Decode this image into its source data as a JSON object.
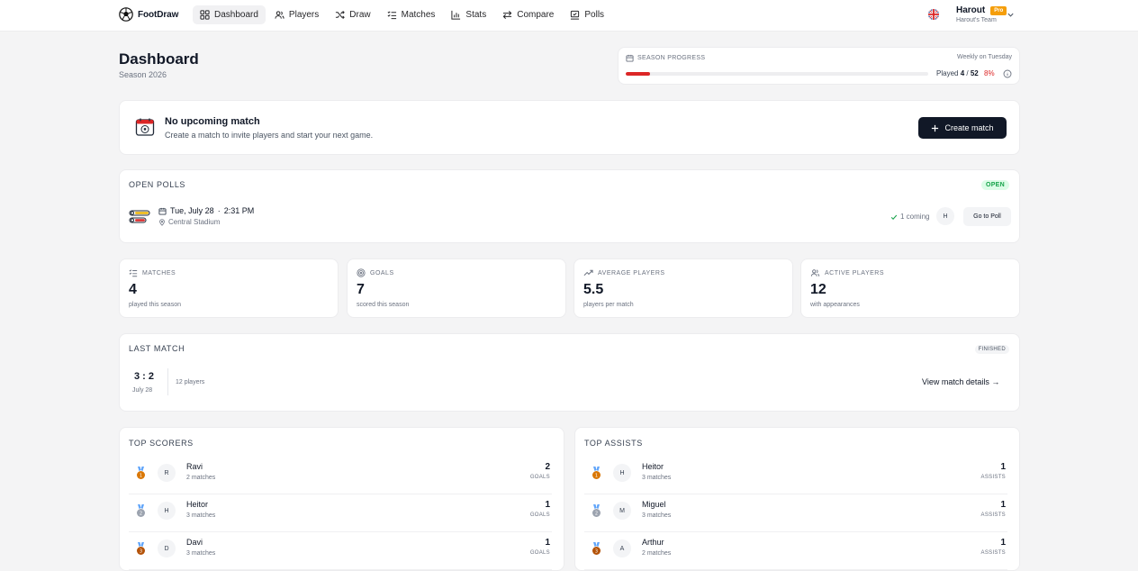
{
  "app": {
    "name": "FootDraw"
  },
  "nav": [
    {
      "label": "Dashboard",
      "icon": "dashboard-icon",
      "active": true
    },
    {
      "label": "Players",
      "icon": "users-icon"
    },
    {
      "label": "Draw",
      "icon": "shuffle-icon"
    },
    {
      "label": "Matches",
      "icon": "list-icon"
    },
    {
      "label": "Stats",
      "icon": "bar-chart-icon"
    },
    {
      "label": "Compare",
      "icon": "compare-icon"
    },
    {
      "label": "Polls",
      "icon": "poll-icon"
    }
  ],
  "user": {
    "name": "Harout",
    "badge": "Pro",
    "team": "Harout's Team"
  },
  "page": {
    "title": "Dashboard",
    "subtitle": "Season 2026"
  },
  "season_progress": {
    "label": "SEASON PROGRESS",
    "schedule": "Weekly on Tuesday",
    "played_prefix": "Played",
    "played": "4",
    "separator": "/",
    "total": "52",
    "percent_label": "8%",
    "percent": 8,
    "accent": "#dc2626"
  },
  "upcoming": {
    "title": "No upcoming match",
    "description": "Create a match to invite players and start your next game.",
    "button": "Create match"
  },
  "polls": {
    "title": "OPEN POLLS",
    "status": "OPEN",
    "date": "Tue, July 28",
    "dot": "·",
    "time": "2:31 PM",
    "location": "Central Stadium",
    "coming": "1 coming",
    "avatar": "H",
    "button": "Go to Poll"
  },
  "stats": [
    {
      "label": "MATCHES",
      "value": "4",
      "sub": "played this season",
      "icon": "list-icon"
    },
    {
      "label": "GOALS",
      "value": "7",
      "sub": "scored this season",
      "icon": "target-icon"
    },
    {
      "label": "AVERAGE PLAYERS",
      "value": "5.5",
      "sub": "players per match",
      "icon": "trend-icon"
    },
    {
      "label": "ACTIVE PLAYERS",
      "value": "12",
      "sub": "with appearances",
      "icon": "users-icon"
    }
  ],
  "last_match": {
    "title": "LAST MATCH",
    "status": "FINISHED",
    "score": "3 : 2",
    "date": "July 28",
    "players": "12 players",
    "link": "View match details →"
  },
  "top_scorers": {
    "title": "TOP SCORERS",
    "rows": [
      {
        "initial": "R",
        "name": "Ravi",
        "matches": "2 matches",
        "value": "2",
        "unit": "GOALS"
      },
      {
        "initial": "H",
        "name": "Heitor",
        "matches": "3 matches",
        "value": "1",
        "unit": "GOALS"
      },
      {
        "initial": "D",
        "name": "Davi",
        "matches": "3 matches",
        "value": "1",
        "unit": "GOALS"
      }
    ]
  },
  "top_assists": {
    "title": "TOP ASSISTS",
    "rows": [
      {
        "initial": "H",
        "name": "Heitor",
        "matches": "3 matches",
        "value": "1",
        "unit": "ASSISTS"
      },
      {
        "initial": "M",
        "name": "Miguel",
        "matches": "3 matches",
        "value": "1",
        "unit": "ASSISTS"
      },
      {
        "initial": "A",
        "name": "Arthur",
        "matches": "2 matches",
        "value": "1",
        "unit": "ASSISTS"
      }
    ]
  },
  "medal_colors": [
    "#d97706",
    "#9ca3af",
    "#b45309"
  ]
}
